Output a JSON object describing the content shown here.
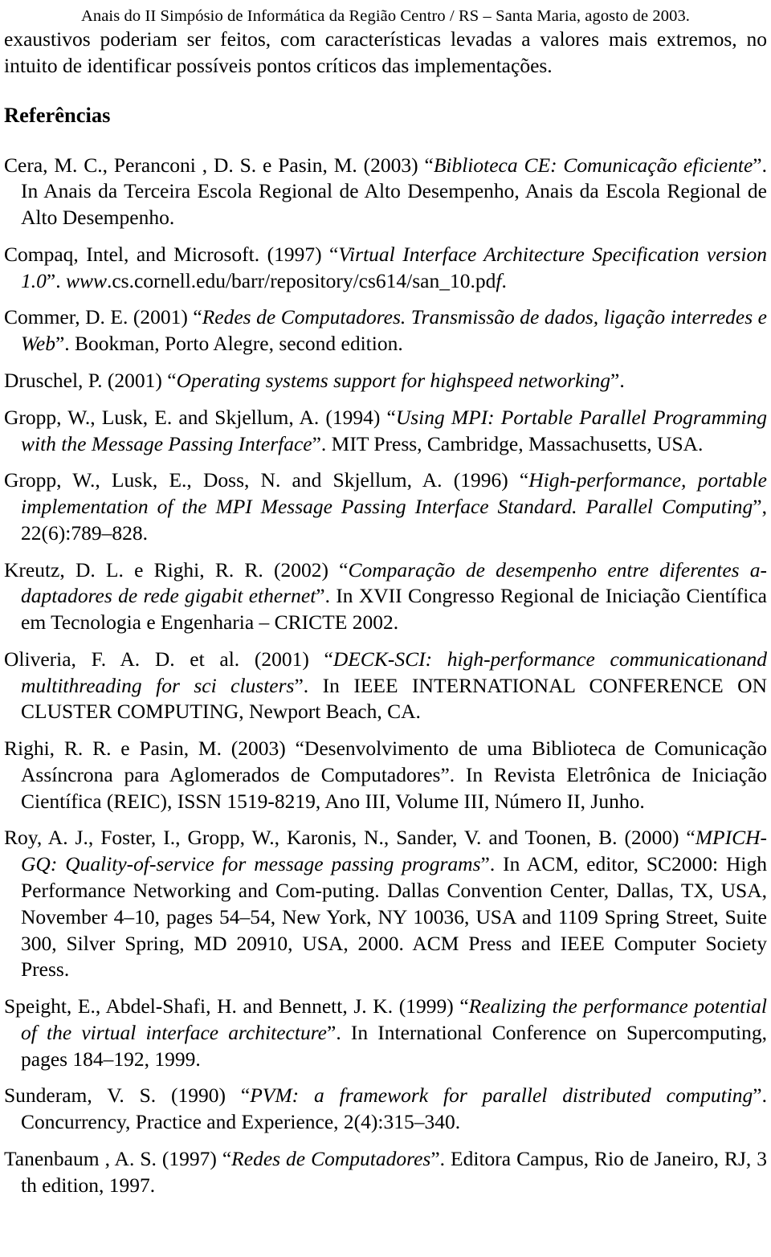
{
  "running_head": "Anais do II Simpósio de Informática da Região Centro / RS – Santa Maria, agosto de 2003.",
  "intro_paragraph": "exaustivos poderiam ser feitos, com características levadas a valores mais extremos, no intuito de identificar possíveis pontos críticos das implementações.",
  "section_heading": "Referências",
  "references": [
    {
      "id": "ref-cera-2003",
      "prefix": "Cera, M. C., Peranconi , D. S. e Pasin, M. (2003) “",
      "title": "Biblioteca CE: Comunicação eficiente",
      "suffix": "”. In Anais da Terceira Escola Regional de Alto  Desempenho, Anais da Escola Regional de Alto Desempenho."
    },
    {
      "id": "ref-compaq-1997",
      "prefix": "Compaq, Intel, and Microsoft. (1997) “",
      "title": "Virtual Interface Architecture Specification version 1.0",
      "mid": "”. ",
      "title2": "www",
      "suffix": ".cs.cornell.edu/barr/repository/cs614/san_10.pd",
      "tail_italic": "f",
      "tail": "."
    },
    {
      "id": "ref-commer-2001",
      "prefix": "Commer, D. E. (2001) “",
      "title": "Redes de Computadores. Transmissão de dados, ligação interredes e Web",
      "suffix": "”. Bookman, Porto Alegre, second edition."
    },
    {
      "id": "ref-druschel-2001",
      "prefix": "Druschel, P. (2001) “",
      "title": "Operating systems support for highspeed networking",
      "suffix": "”."
    },
    {
      "id": "ref-gropp-1994",
      "prefix": "Gropp, W., Lusk, E. and Skjellum, A. (1994) “",
      "title": "Using MPI: Portable Parallel Programming with the Message Passing Interface",
      "suffix": "”. MIT Press, Cambridge, Massachusetts, USA."
    },
    {
      "id": "ref-gropp-1996",
      "prefix": "Gropp, W., Lusk, E., Doss, N. and Skjellum, A. (1996) “",
      "title": "High-performance, portable implementation of the MPI Message Passing Interface Standard. Parallel Computing",
      "suffix": "”, 22(6):789–828."
    },
    {
      "id": "ref-kreutz-2002",
      "prefix": "Kreutz, D. L. e Righi, R. R. (2002) “",
      "title": "Comparação de desempenho entre diferentes a-daptadores de rede gigabit ethernet",
      "suffix": "”. In XVII Congresso Regional de Iniciação Científica em Tecnologia e Engenharia – CRICTE 2002."
    },
    {
      "id": "ref-oliveria-2001",
      "prefix": "Oliveria, F. A. D. et al. (2001) “",
      "title": "DECK-SCI: high-performance communicationand multithreading for sci clusters",
      "suffix": "”. In IEEE INTERNATIONAL CONFERENCE ON CLUSTER COMPUTING, Newport Beach, CA."
    },
    {
      "id": "ref-righi-2003",
      "prefix": "Righi, R. R. e Pasin, M. (2003) “Desenvolvimento de uma Biblioteca de Comunicação Assíncrona para Aglomerados de Computadores”. In Revista Eletrônica de Iniciação Científica (REIC), ISSN 1519-8219,  Ano III, Volume III, Número II, Junho.",
      "title": "",
      "suffix": ""
    },
    {
      "id": "ref-roy-2000",
      "prefix": "Roy, A. J.,  Foster, I., Gropp, W., Karonis, N., Sander, V. and Toonen, B. (2000) “",
      "title": "MPICH-GQ: Quality-of-service for message passing programs",
      "suffix": "”. In ACM, editor, SC2000: High Performance Networking and Com-puting. Dallas Convention Center, Dallas, TX, USA, November 4–10, pages 54–54, New York, NY 10036, USA and 1109 Spring Street, Suite 300, Silver Spring, MD 20910, USA, 2000. ACM Press and IEEE Computer Society Press."
    },
    {
      "id": "ref-speight-1999",
      "prefix": "Speight, E.,  Abdel-Shafi, H. and Bennett, J. K. (1999) “",
      "title": "Realizing the performance potential of the virtual interface architecture",
      "suffix": "”. In International Conference on Supercomputing, pages 184–192, 1999."
    },
    {
      "id": "ref-sunderam-1990",
      "prefix": "Sunderam, V. S. (1990) “",
      "title": "PVM: a framework for parallel distributed computing",
      "suffix": "”. Concurrency, Practice and Experience, 2(4):315–340."
    },
    {
      "id": "ref-tanenbaum-1997",
      "prefix": "Tanenbaum , A. S. (1997) “",
      "title": "Redes de Computadores",
      "suffix": "”. Editora Campus, Rio de Janeiro, RJ, 3 th edition, 1997."
    }
  ]
}
